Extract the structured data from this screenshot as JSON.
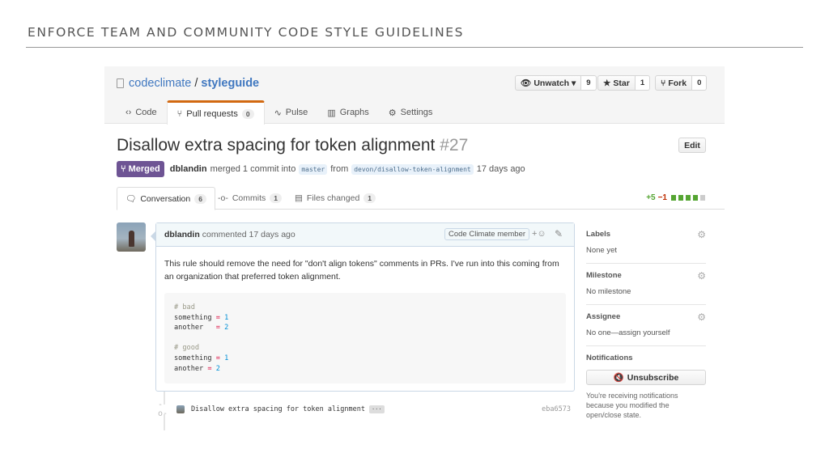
{
  "slide": {
    "title": "ENFORCE TEAM AND COMMUNITY CODE STYLE GUIDELINES"
  },
  "repo": {
    "owner": "codeclimate",
    "separator": "/",
    "name": "styleguide"
  },
  "actions": [
    {
      "label": "Unwatch ▾",
      "icon": "eye-icon",
      "count": "9"
    },
    {
      "label": "Star",
      "icon": "star-icon",
      "count": "1"
    },
    {
      "label": "Fork",
      "icon": "fork-icon",
      "count": "0"
    }
  ],
  "tabs": [
    {
      "label": "Code",
      "icon": "code-icon"
    },
    {
      "label": "Pull requests",
      "icon": "pull-request-icon",
      "count": "0"
    },
    {
      "label": "Pulse",
      "icon": "pulse-icon"
    },
    {
      "label": "Graphs",
      "icon": "graph-icon"
    },
    {
      "label": "Settings",
      "icon": "gear-icon"
    }
  ],
  "pr": {
    "title": "Disallow extra spacing for token alignment",
    "number": "#27",
    "edit_label": "Edit",
    "state": "Merged",
    "author": "dblandin",
    "merge_text": "merged 1 commit into",
    "base_branch": "master",
    "from_text": "from",
    "head_branch": "devon/disallow-token-alignment",
    "time_ago": "17 days ago"
  },
  "pr_tabs": [
    {
      "label": "Conversation",
      "count": "6"
    },
    {
      "label": "Commits",
      "count": "1"
    },
    {
      "label": "Files changed",
      "count": "1"
    }
  ],
  "diffstat": {
    "additions": "+5",
    "deletions": "−1"
  },
  "comment": {
    "author": "dblandin",
    "action": "commented 17 days ago",
    "badge": "Code Climate member",
    "body": "This rule should remove the need for \"don't align tokens\" comments in PRs. I've run into this coming from an organization that preferred token alignment.",
    "code": {
      "bad_comment": "# bad",
      "good_comment": "# good",
      "var1": "something",
      "var2": "another",
      "val1": "1",
      "val2": "2"
    }
  },
  "commit": {
    "message": "Disallow extra spacing for token alignment",
    "ellipsis": "···",
    "sha": "eba6573"
  },
  "sidebar": {
    "labels": {
      "heading": "Labels",
      "value": "None yet"
    },
    "milestone": {
      "heading": "Milestone",
      "value": "No milestone"
    },
    "assignee": {
      "heading": "Assignee",
      "value": "No one—assign yourself"
    },
    "notifications": {
      "heading": "Notifications",
      "button": "Unsubscribe",
      "note": "You're receiving notifications because you modified the open/close state."
    }
  },
  "colors": {
    "merged": "#6e5494",
    "tab_accent": "#d26911",
    "link": "#4078c0",
    "additions": "#55a532",
    "deletions": "#bd2c00"
  }
}
